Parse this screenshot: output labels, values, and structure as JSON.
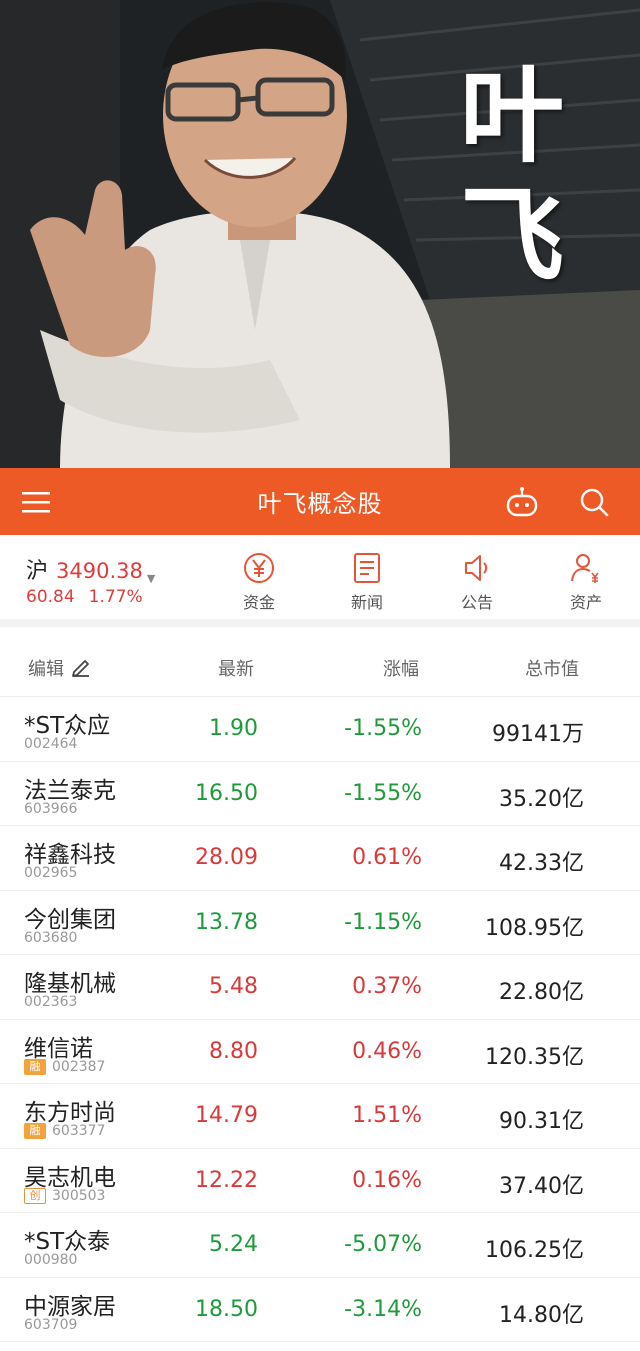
{
  "banner": {
    "caption_line1": "叶",
    "caption_line2": "飞"
  },
  "header": {
    "title": "叶飞概念股",
    "icons": {
      "menu": "menu-icon",
      "robot": "robot-icon",
      "search": "search-icon"
    }
  },
  "index": {
    "name": "沪",
    "value": "3490.38",
    "change": "60.84",
    "change_pct": "1.77%"
  },
  "quick_actions": [
    {
      "label": "资金",
      "icon": "yuan-circle-icon"
    },
    {
      "label": "新闻",
      "icon": "news-icon"
    },
    {
      "label": "公告",
      "icon": "speaker-icon"
    },
    {
      "label": "资产",
      "icon": "user-asset-icon"
    }
  ],
  "table": {
    "headers": {
      "edit": "编辑",
      "latest": "最新",
      "change": "涨幅",
      "cap": "总市值"
    },
    "rows": [
      {
        "name": "*ST众应",
        "code": "002464",
        "tag": "",
        "price": "1.90",
        "pct": "-1.55%",
        "cap": "99141万",
        "dir": "down"
      },
      {
        "name": "法兰泰克",
        "code": "603966",
        "tag": "",
        "price": "16.50",
        "pct": "-1.55%",
        "cap": "35.20亿",
        "dir": "down"
      },
      {
        "name": "祥鑫科技",
        "code": "002965",
        "tag": "",
        "price": "28.09",
        "pct": "0.61%",
        "cap": "42.33亿",
        "dir": "up"
      },
      {
        "name": "今创集团",
        "code": "603680",
        "tag": "",
        "price": "13.78",
        "pct": "-1.15%",
        "cap": "108.95亿",
        "dir": "down"
      },
      {
        "name": "隆基机械",
        "code": "002363",
        "tag": "",
        "price": "5.48",
        "pct": "0.37%",
        "cap": "22.80亿",
        "dir": "up"
      },
      {
        "name": "维信诺",
        "code": "002387",
        "tag": "融",
        "price": "8.80",
        "pct": "0.46%",
        "cap": "120.35亿",
        "dir": "up"
      },
      {
        "name": "东方时尚",
        "code": "603377",
        "tag": "融",
        "price": "14.79",
        "pct": "1.51%",
        "cap": "90.31亿",
        "dir": "up"
      },
      {
        "name": "昊志机电",
        "code": "300503",
        "tag": "创",
        "price": "12.22",
        "pct": "0.16%",
        "cap": "37.40亿",
        "dir": "up"
      },
      {
        "name": "*ST众泰",
        "code": "000980",
        "tag": "",
        "price": "5.24",
        "pct": "-5.07%",
        "cap": "106.25亿",
        "dir": "down"
      },
      {
        "name": "中源家居",
        "code": "603709",
        "tag": "",
        "price": "18.50",
        "pct": "-3.14%",
        "cap": "14.80亿",
        "dir": "down"
      }
    ]
  },
  "colors": {
    "accent": "#ee5a25",
    "up": "#d83a3a",
    "down": "#1f9a3b"
  }
}
